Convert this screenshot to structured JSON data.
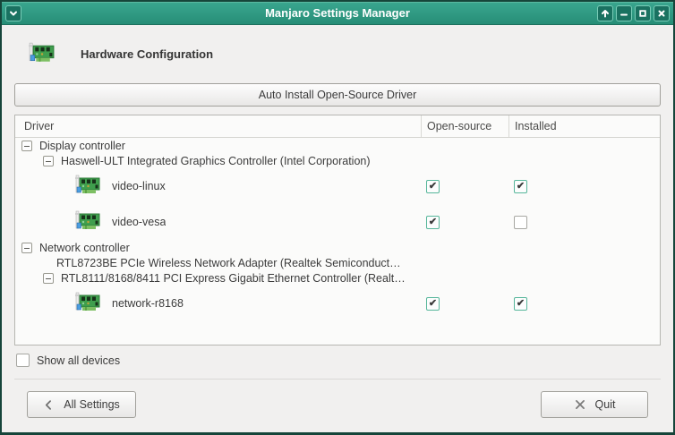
{
  "window": {
    "title": "Manjaro Settings Manager",
    "controls": {
      "menu": "window menu",
      "keep_above": "keep above",
      "minimize": "minimize",
      "maximize": "maximize",
      "close": "close"
    }
  },
  "colors": {
    "titlebar_teal": "#2f9c84",
    "titlebar_button_bg": "#1a7261",
    "titlebar_button_border": "#79ccb7",
    "window_border": "#16453a",
    "content_bg": "#f1f0ef",
    "checkbox_checked_border": "#56b69a"
  },
  "header": {
    "title": "Hardware Configuration",
    "icon": "pci-card-icon"
  },
  "auto_install_button": {
    "label": "Auto Install Open-Source Driver"
  },
  "table": {
    "columns": [
      "Driver",
      "Open-source",
      "Installed"
    ],
    "rows": [
      {
        "kind": "group",
        "level": 0,
        "has_expander": true,
        "label": "Display controller"
      },
      {
        "kind": "group",
        "level": 1,
        "has_expander": true,
        "label": "Haswell-ULT Integrated Graphics Controller (Intel Corporation)"
      },
      {
        "kind": "driver",
        "level": 2,
        "has_expander": false,
        "label": "video-linux",
        "open_source": true,
        "installed": true
      },
      {
        "kind": "driver",
        "level": 2,
        "has_expander": false,
        "label": "video-vesa",
        "open_source": true,
        "installed": false
      },
      {
        "kind": "group",
        "level": 0,
        "has_expander": true,
        "label": "Network controller"
      },
      {
        "kind": "group",
        "level": 1,
        "has_expander": false,
        "label": "RTL8723BE PCIe Wireless Network Adapter (Realtek Semiconduct…"
      },
      {
        "kind": "group",
        "level": 1,
        "has_expander": true,
        "label": "RTL8111/8168/8411 PCI Express Gigabit Ethernet Controller (Realt…"
      },
      {
        "kind": "driver",
        "level": 2,
        "has_expander": false,
        "label": "network-r8168",
        "open_source": true,
        "installed": true
      }
    ]
  },
  "show_all_devices": {
    "label": "Show all devices",
    "checked": false
  },
  "footer": {
    "all_settings_label": "All Settings",
    "quit_label": "Quit"
  }
}
